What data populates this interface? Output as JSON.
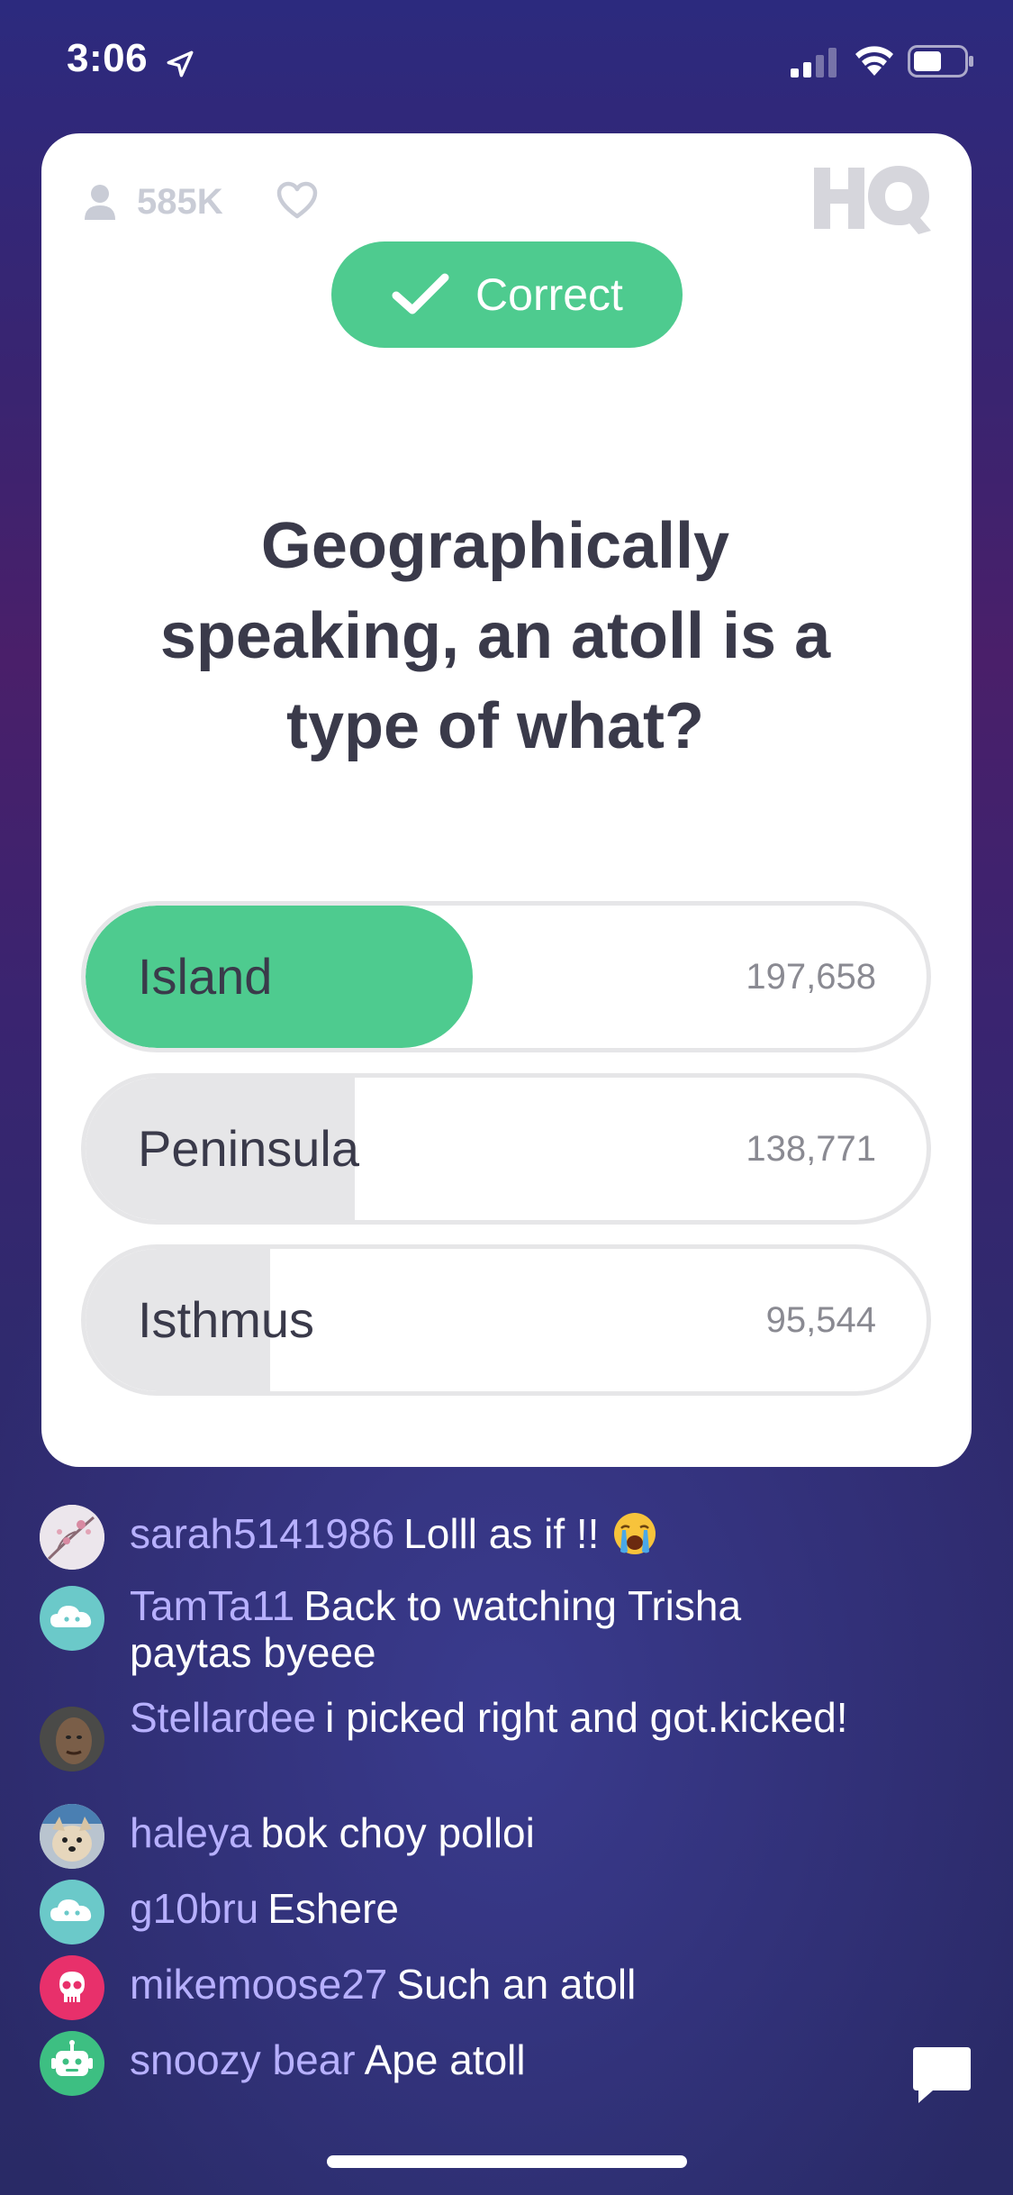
{
  "status_bar": {
    "time": "3:06"
  },
  "header": {
    "viewers": "585K"
  },
  "result_badge": {
    "label": "Correct"
  },
  "question": "Geographically speaking, an atoll is a type of what?",
  "answers": [
    {
      "label": "Island",
      "count": "197,658",
      "fill_fraction": 0.46,
      "is_correct": true
    },
    {
      "label": "Peninsula",
      "count": "138,771",
      "fill_fraction": 0.32,
      "is_correct": false
    },
    {
      "label": "Isthmus",
      "count": "95,544",
      "fill_fraction": 0.22,
      "is_correct": false
    }
  ],
  "chat": [
    {
      "user": "sarah5141986",
      "message": "Lolll as if !!",
      "emoji": "crying-face",
      "avatar": "photo-blossom"
    },
    {
      "user": "TamTa11",
      "message": "Back to watching Trisha paytas byeee",
      "avatar": "cloud"
    },
    {
      "user": "Stellardee",
      "message": "i picked right and got.kicked!",
      "avatar": "photo-person"
    },
    {
      "user": "haleya",
      "message": "bok choy polloi",
      "avatar": "photo-dog"
    },
    {
      "user": "g10bru",
      "message": "Eshere",
      "avatar": "cloud"
    },
    {
      "user": "mikemoose27",
      "message": "Such an atoll",
      "avatar": "skull"
    },
    {
      "user": "snoozy bear",
      "message": "Ape atoll",
      "avatar": "robot"
    }
  ],
  "colors": {
    "correct_green": "#4ecb8f",
    "answer_fill_grey": "#e6e6e8",
    "username_purple": "#b7b0ff",
    "avatar_cloud": "#6bc9c9",
    "avatar_skull": "#e8306b",
    "avatar_robot": "#3dbf82"
  }
}
